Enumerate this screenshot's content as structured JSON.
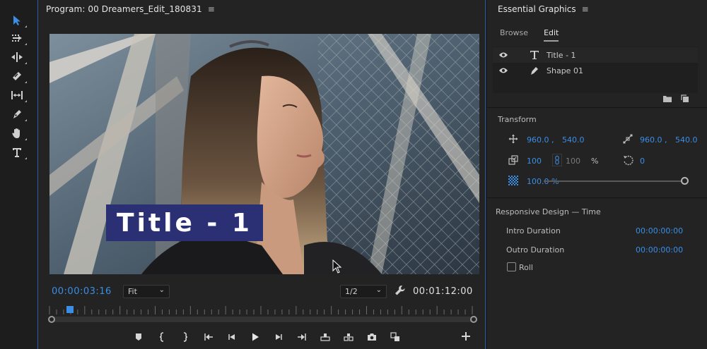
{
  "tools": [
    {
      "name": "selection-tool-icon",
      "active": true
    },
    {
      "name": "track-select-forward-icon"
    },
    {
      "name": "ripple-edit-icon"
    },
    {
      "name": "razor-icon"
    },
    {
      "name": "slip-icon"
    },
    {
      "name": "pen-icon"
    },
    {
      "name": "hand-icon"
    },
    {
      "name": "type-icon"
    }
  ],
  "program": {
    "title": "Program: 00 Dreamers_Edit_180831",
    "menu": "≡",
    "overlay_title": "Title - 1",
    "timecode_current": "00:00:03:16",
    "zoom_value": "Fit",
    "resolution_value": "1/2",
    "timecode_duration": "00:01:12:00",
    "playhead_progress": 0.04
  },
  "essential_graphics": {
    "title": "Essential Graphics",
    "menu": "≡",
    "tabs": [
      {
        "label": "Browse",
        "active": false
      },
      {
        "label": "Edit",
        "active": true
      }
    ],
    "layers": [
      {
        "name": "Title - 1",
        "type_icon": "type-icon"
      },
      {
        "name": "Shape 01",
        "type_icon": "pen-icon"
      }
    ],
    "transform": {
      "label": "Transform",
      "position_x": "960.0 ,",
      "position_y": "540.0",
      "anchor_x": "960.0 ,",
      "anchor_y": "540.0",
      "scale": "100",
      "scale_linked": "100",
      "scale_unit": "%",
      "rotation": "0",
      "opacity": "100.0 %"
    },
    "responsive": {
      "label": "Responsive Design — Time",
      "intro_label": "Intro Duration",
      "intro_value": "00:00:00:00",
      "outro_label": "Outro Duration",
      "outro_value": "00:00:00:00",
      "roll_label": "Roll",
      "roll_checked": false
    }
  },
  "colors": {
    "accent": "#3a8ee6",
    "title_box": "#2b2f73",
    "panel": "#232323"
  }
}
